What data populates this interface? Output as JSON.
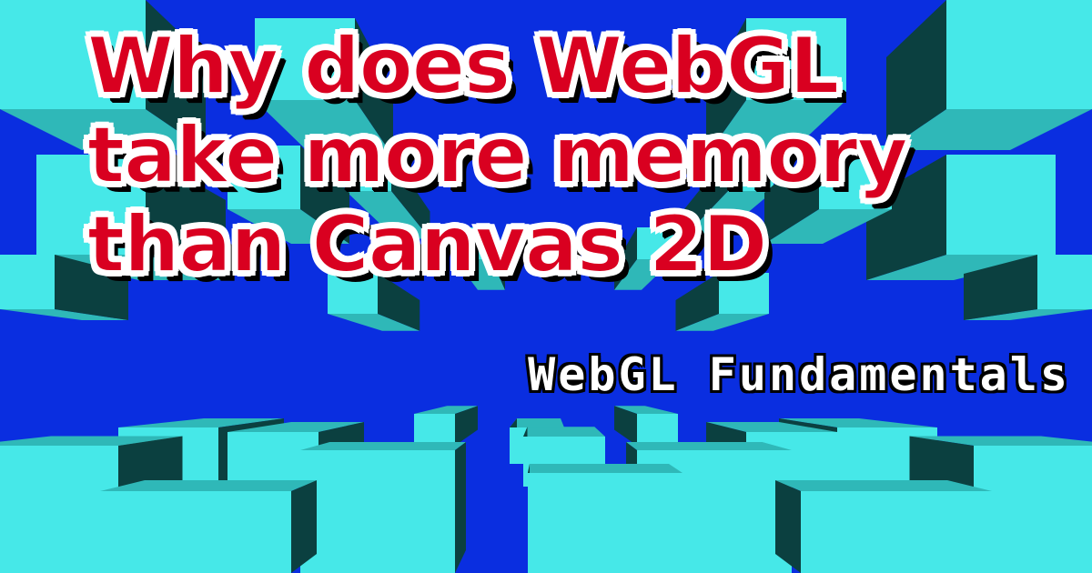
{
  "title_lines": [
    "Why does WebGL",
    "take more memory",
    "than Canvas 2D"
  ],
  "subtitle": "WebGL Fundamentals",
  "colors": {
    "background": "#0a2ee0",
    "cube_front": "#46e8e8",
    "cube_side": "#0b4040",
    "cube_top": "#2fb8b8",
    "title_fill": "#d90020",
    "title_outline": "#ffffff",
    "subtitle_fill": "#ffffff"
  }
}
